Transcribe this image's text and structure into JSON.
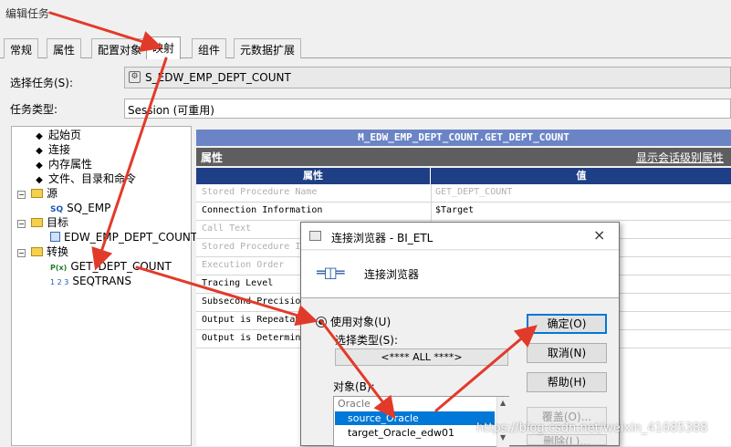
{
  "window": {
    "title": "编辑任务"
  },
  "tabs": [
    "常规",
    "属性",
    "配置对象",
    "映射",
    "组件",
    "元数据扩展"
  ],
  "task": {
    "select_label": "选择任务(S):",
    "select_value": "S_EDW_EMP_DEPT_COUNT",
    "type_label": "任务类型:",
    "type_value": "Session (可重用)"
  },
  "tree": {
    "start_page": "起始页",
    "connection": "连接",
    "memory_props": "内存属性",
    "files_dirs": "文件、目录和命令",
    "source": "源",
    "source_child": "SQ_EMP",
    "target": "目标",
    "target_child": "EDW_EMP_DEPT_COUNT",
    "transform": "转换",
    "transform_child1": "GET_DEPT_COUNT",
    "transform_child2": "SEQTRANS",
    "sq_icon": "SQ",
    "pq_icon": "P(x)",
    "seq_icon": "1 2 3"
  },
  "properties": {
    "header": "M_EDW_EMP_DEPT_COUNT.GET_DEPT_COUNT",
    "section_label": "属性",
    "session_link": "显示会话级别属性",
    "col_attr": "属性",
    "col_value": "值",
    "rows": [
      {
        "k": "Stored Procedure Name",
        "v": "GET_DEPT_COUNT"
      },
      {
        "k": "Connection Information",
        "v": "$Target"
      },
      {
        "k": "Call Text",
        "v": ""
      },
      {
        "k": "Stored Procedure I",
        "v": ""
      },
      {
        "k": "Execution Order",
        "v": ""
      },
      {
        "k": "Tracing Level",
        "v": ""
      },
      {
        "k": "Subsecond Precisio",
        "v": ""
      },
      {
        "k": "Output is Repeatab",
        "v": ""
      },
      {
        "k": "Output is Determin",
        "v": ""
      }
    ]
  },
  "dialog": {
    "title": "连接浏览器 - BI_ETL",
    "close": "×",
    "heading": "连接浏览器",
    "use_object": "使用对象(U)",
    "select_type_label": "选择类型(S):",
    "select_type_value": "<**** ALL ****>",
    "object_label": "对象(B):",
    "objects": {
      "group": "Oracle",
      "selected": "source_Oracle",
      "other": "target_Oracle_edw01"
    },
    "buttons": {
      "ok": "确定(O)",
      "cancel": "取消(N)",
      "help": "帮助(H)",
      "override": "覆盖(O)...",
      "delete": "删除(L)..."
    }
  },
  "watermark": "https://blog.csdn.net/weixin_41685388",
  "colors": {
    "annotation_arrow": "#e23a2a",
    "selection": "#0078d7",
    "header_blue": "#6a84c6",
    "column_header_blue": "#1e3f86"
  }
}
